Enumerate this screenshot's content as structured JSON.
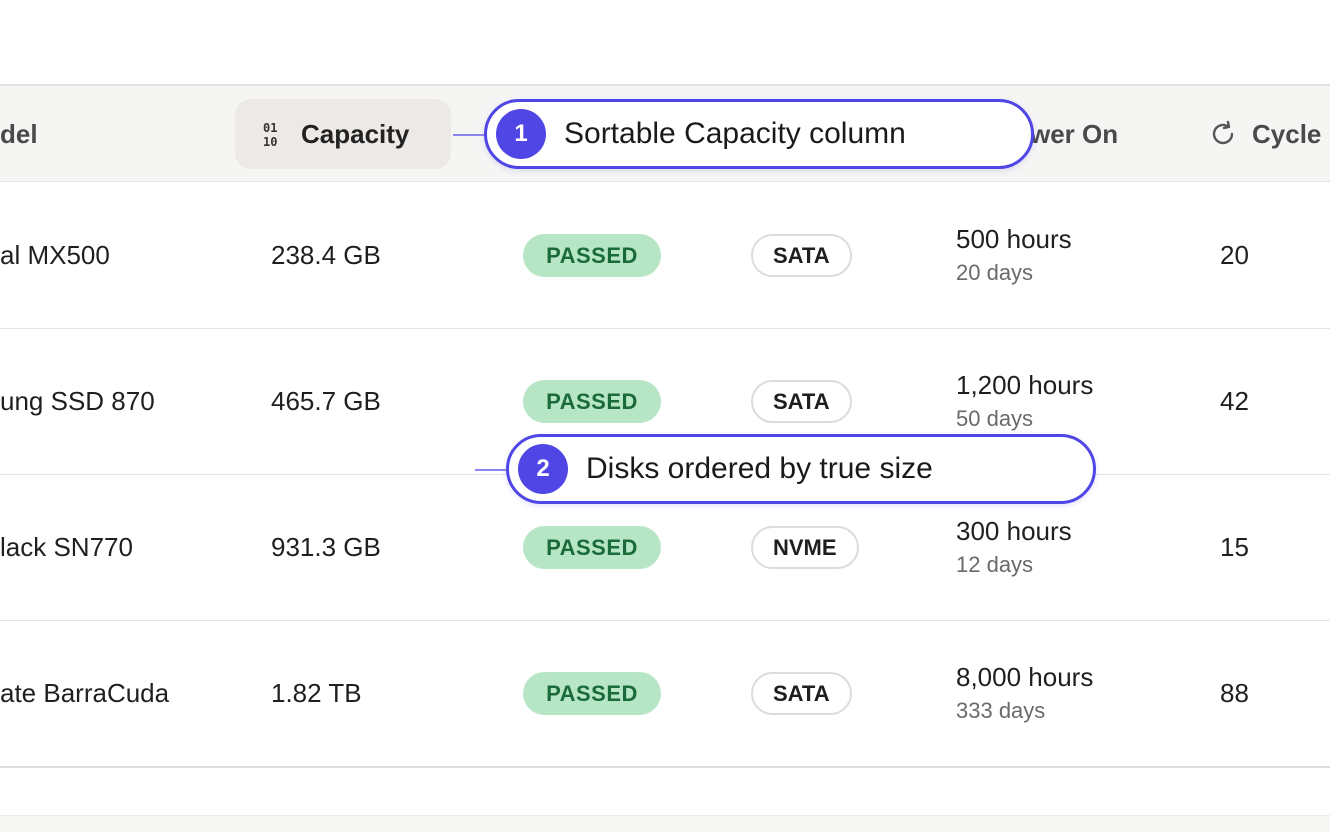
{
  "header": {
    "model": "del",
    "capacity": "Capacity",
    "power_on": "wer On",
    "cycles": "Cycle"
  },
  "rows": [
    {
      "model": "al MX500",
      "capacity": "238.4 GB",
      "smart": "PASSED",
      "interface": "SATA",
      "hours": "500 hours",
      "days": "20 days",
      "cycles": "20"
    },
    {
      "model": "ung SSD 870",
      "capacity": "465.7 GB",
      "smart": "PASSED",
      "interface": "SATA",
      "hours": "1,200 hours",
      "days": "50 days",
      "cycles": "42"
    },
    {
      "model": "lack SN770",
      "capacity": "931.3 GB",
      "smart": "PASSED",
      "interface": "NVME",
      "hours": "300 hours",
      "days": "12 days",
      "cycles": "15"
    },
    {
      "model": "ate BarraCuda",
      "capacity": "1.82 TB",
      "smart": "PASSED",
      "interface": "SATA",
      "hours": "8,000 hours",
      "days": "333 days",
      "cycles": "88"
    }
  ],
  "callouts": [
    {
      "number": "1",
      "text": "Sortable Capacity column"
    },
    {
      "number": "2",
      "text": "Disks ordered by true size"
    }
  ],
  "icons": {
    "sort": "sort-numeric-icon",
    "cycles": "refresh-icon"
  },
  "colors": {
    "accent": "#4f46e5",
    "passed_bg": "#b7e6c6",
    "passed_text": "#1b6b3a"
  }
}
